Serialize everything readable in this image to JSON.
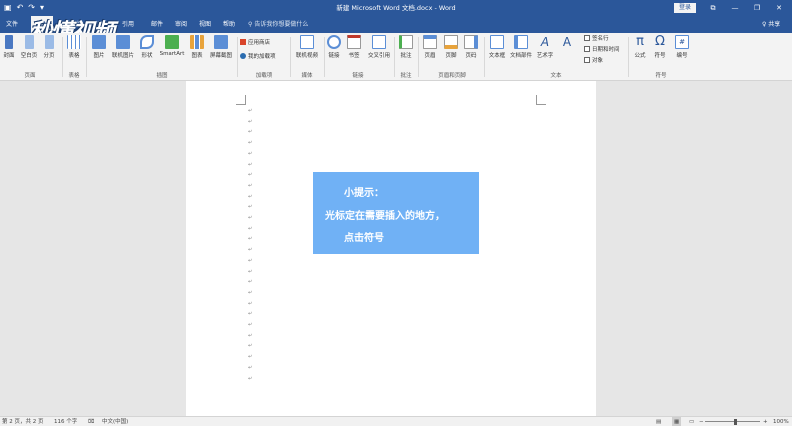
{
  "app": {
    "title": "新建 Microsoft Word 文档.docx - Word",
    "login": "登录",
    "share": "♀ 共享",
    "tell_me": "告诉我你想要做什么",
    "window_buttons": [
      "⧉",
      "—",
      "❐",
      "✕"
    ],
    "qat_icons": [
      "save-icon",
      "undo-icon",
      "redo-icon",
      "customize-icon"
    ]
  },
  "tabs": [
    "文件",
    "插入",
    "设计",
    "布局",
    "引用",
    "邮件",
    "审阅",
    "视图",
    "帮助"
  ],
  "watermark": "秒懂视频",
  "ribbon": {
    "buttons": [
      {
        "label": "封面",
        "icon": "cover-icon",
        "color": "#4a78c2"
      },
      {
        "label": "空白页",
        "icon": "blank-page-icon",
        "color": "#9bbbe6"
      },
      {
        "label": "分页",
        "icon": "page-break-icon",
        "color": "#9bbbe6"
      },
      {
        "label": "表格",
        "icon": "table-icon",
        "color": "#5b8ed6"
      },
      {
        "label": "图片",
        "icon": "picture-icon",
        "color": "#5b8ed6"
      },
      {
        "label": "联机图片",
        "icon": "online-picture-icon",
        "color": "#5b8ed6"
      },
      {
        "label": "形状",
        "icon": "shapes-icon",
        "color": "#5b8ed6"
      },
      {
        "label": "SmartArt",
        "icon": "smartart-icon",
        "color": "#4caf50"
      },
      {
        "label": "图表",
        "icon": "chart-icon",
        "color": "#e8a33b"
      },
      {
        "label": "屏幕截图",
        "icon": "screenshot-icon",
        "color": "#5b8ed6"
      },
      {
        "label": "联机视频",
        "icon": "online-video-icon",
        "color": "#5b8ed6"
      },
      {
        "label": "链接",
        "icon": "link-icon",
        "color": "#5b8ed6"
      },
      {
        "label": "书签",
        "icon": "bookmark-icon",
        "color": "#c0392b"
      },
      {
        "label": "交叉引用",
        "icon": "cross-reference-icon",
        "color": "#5b8ed6"
      },
      {
        "label": "批注",
        "icon": "comment-icon",
        "color": "#4caf50"
      },
      {
        "label": "页眉",
        "icon": "header-icon",
        "color": "#5b8ed6"
      },
      {
        "label": "页脚",
        "icon": "footer-icon",
        "color": "#5b8ed6"
      },
      {
        "label": "页码",
        "icon": "page-number-icon",
        "color": "#5b8ed6"
      },
      {
        "label": "文本框",
        "icon": "text-box-icon",
        "color": "#5b8ed6"
      },
      {
        "label": "文档部件",
        "icon": "quick-parts-icon",
        "color": "#5b8ed6"
      },
      {
        "label": "艺术字",
        "icon": "wordart-icon",
        "color": "#2b579a"
      },
      {
        "label": "公式",
        "icon": "equation-icon",
        "color": "#2b579a"
      },
      {
        "label": "符号",
        "icon": "symbol-icon",
        "color": "#2b579a"
      },
      {
        "label": "编号",
        "icon": "number-icon",
        "color": "#5b8ed6"
      }
    ],
    "small_items": [
      {
        "label": "应用商店",
        "icon": "store-icon",
        "color": "#d9452b"
      },
      {
        "label": "我的加载项",
        "icon": "my-addins-icon",
        "color": "#2b6cb0"
      },
      {
        "label": "签名行",
        "icon": "signature-line-icon",
        "color": "#666666"
      },
      {
        "label": "日期和时间",
        "icon": "date-time-icon",
        "color": "#666666"
      },
      {
        "label": "对象",
        "icon": "object-icon",
        "color": "#666666"
      }
    ],
    "groups": [
      "页面",
      "表格",
      "插图",
      "加载项",
      "媒体",
      "链接",
      "批注",
      "页眉和页脚",
      "文本",
      "符号"
    ]
  },
  "document": {
    "paragraph_mark": "↵",
    "paragraph_count": 26,
    "tip_lines": [
      "小提示：",
      "光标定在需要插入的地方，",
      "点击符号"
    ],
    "tip_color": "#70b1f5"
  },
  "statusbar": {
    "page": "第 2 页，共 2 页",
    "words": "116 个字",
    "language": "中文(中国)",
    "zoom": "100%",
    "zoom_minus": "−",
    "zoom_plus": "+"
  }
}
